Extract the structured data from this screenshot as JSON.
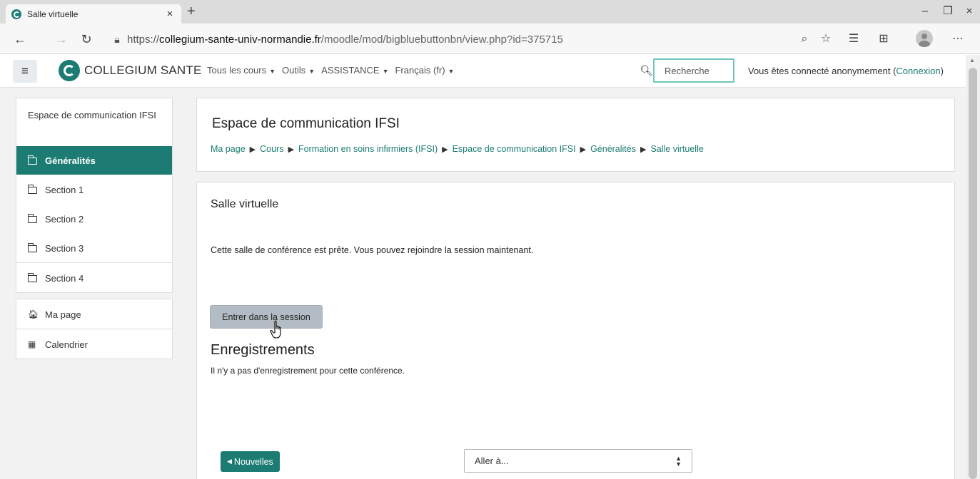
{
  "browser": {
    "tab_title": "Salle virtuelle",
    "tab_close": "×",
    "new_tab": "+",
    "window": {
      "minimize": "–",
      "restore": "❐",
      "close": "×"
    },
    "url_prefix": "https://",
    "url_host": "collegium-sante-univ-normandie.fr",
    "url_path": "/moodle/mod/bigbluebuttonbn/view.php?id=375715"
  },
  "header": {
    "brand": "COLLEGIUM SANTE",
    "menu": [
      {
        "label": "Tous les cours"
      },
      {
        "label": "Outils"
      },
      {
        "label": "ASSISTANCE"
      },
      {
        "label": "Français (fr)"
      }
    ],
    "search_placeholder": "Recherche",
    "login_text": "Vous êtes connecté anonymement (",
    "login_link": "Connexion",
    "login_close": ")"
  },
  "sidebar": {
    "course_name": "Espace de communication IFSI",
    "sections": [
      {
        "label": "Généralités",
        "active": true
      },
      {
        "label": "Section 1"
      },
      {
        "label": "Section 2"
      },
      {
        "label": "Section 3"
      },
      {
        "label": "Section 4"
      }
    ],
    "links": [
      {
        "label": "Ma page",
        "icon": "home-icon"
      },
      {
        "label": "Calendrier",
        "icon": "calendar-icon"
      }
    ]
  },
  "page": {
    "title": "Espace de communication IFSI",
    "breadcrumb": [
      "Ma page",
      "Cours",
      "Formation en soins infirmiers (IFSI)",
      "Espace de communication IFSI",
      "Généralités",
      "Salle virtuelle"
    ],
    "breadcrumb_separator": "▶"
  },
  "activity": {
    "title": "Salle virtuelle",
    "status": "Cette salle de conférence est prête. Vous pouvez rejoindre la session maintenant.",
    "join_label": "Entrer dans la session",
    "recordings_title": "Enregistrements",
    "recordings_empty": "Il n'y a pas d'enregistrement pour cette conférence.",
    "prev_activity": "Nouvelles",
    "jump_to": "Aller à..."
  },
  "colors": {
    "brand": "#1c7c74",
    "join_button": "#b3bcc5"
  }
}
